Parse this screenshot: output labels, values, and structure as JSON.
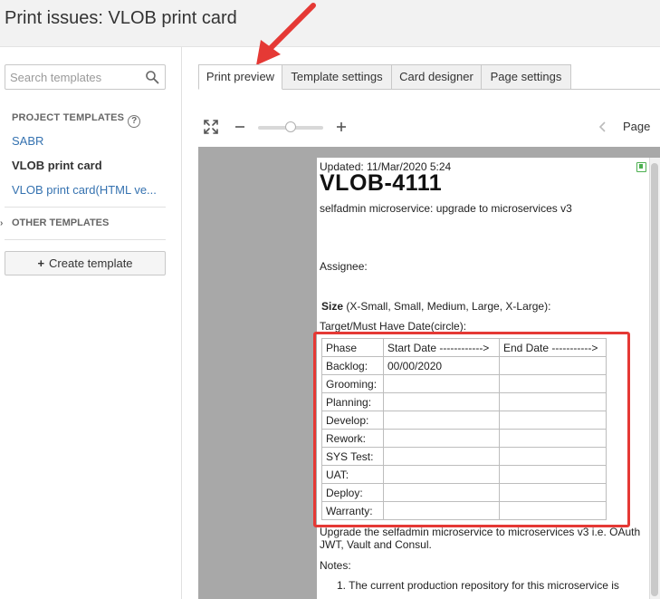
{
  "page": {
    "title": "Print issues: VLOB print card"
  },
  "sidebar": {
    "search_placeholder": "Search templates",
    "project_templates_label": "PROJECT TEMPLATES",
    "help_glyph": "?",
    "templates": [
      {
        "label": "SABR"
      },
      {
        "label": "VLOB print card"
      },
      {
        "label": "VLOB print card(HTML ve..."
      }
    ],
    "other_templates_label": "OTHER TEMPLATES",
    "create_label": "Create template"
  },
  "tabs": [
    {
      "label": "Print preview"
    },
    {
      "label": "Template settings"
    },
    {
      "label": "Card designer"
    },
    {
      "label": "Page settings"
    }
  ],
  "toolbar": {
    "page_label": "Page"
  },
  "card": {
    "updated": "Updated: 11/Mar/2020 5:24",
    "issue_key": "VLOB-4111",
    "summary": "selfadmin microservice: upgrade to microservices v3",
    "assignee": "Assignee:",
    "size_label": "Size",
    "size_options": " (X-Small, Small, Medium, Large, X-Large):",
    "target_label": "Target/Must Have Date(circle):",
    "table": {
      "headers": [
        "Phase",
        "Start Date ------------>",
        "End Date ----------->"
      ],
      "rows": [
        [
          "Backlog:",
          "00/00/2020",
          ""
        ],
        [
          "Grooming:",
          "",
          ""
        ],
        [
          "Planning:",
          "",
          ""
        ],
        [
          "Develop:",
          "",
          ""
        ],
        [
          "Rework:",
          "",
          ""
        ],
        [
          "SYS Test:",
          "",
          ""
        ],
        [
          "UAT:",
          "",
          ""
        ],
        [
          "Deploy:",
          "",
          ""
        ],
        [
          "Warranty:",
          "",
          ""
        ]
      ]
    },
    "description": "Upgrade the selfadmin microservice to microservices v3 i.e. OAuth JWT, Vault and Consul.",
    "notes_label": "Notes:",
    "note_1": "1. The current production repository for this microservice is"
  },
  "colors": {
    "link": "#3572b0",
    "annotation": "#e53935",
    "header_bg": "#f2f2f2"
  },
  "icons": {
    "search": "search-icon",
    "fullscreen": "fullscreen-icon",
    "zoom_out": "minus-icon",
    "zoom_in": "plus-icon",
    "prev_page": "chevron-left-icon",
    "bookmark": "bookmark-icon"
  }
}
